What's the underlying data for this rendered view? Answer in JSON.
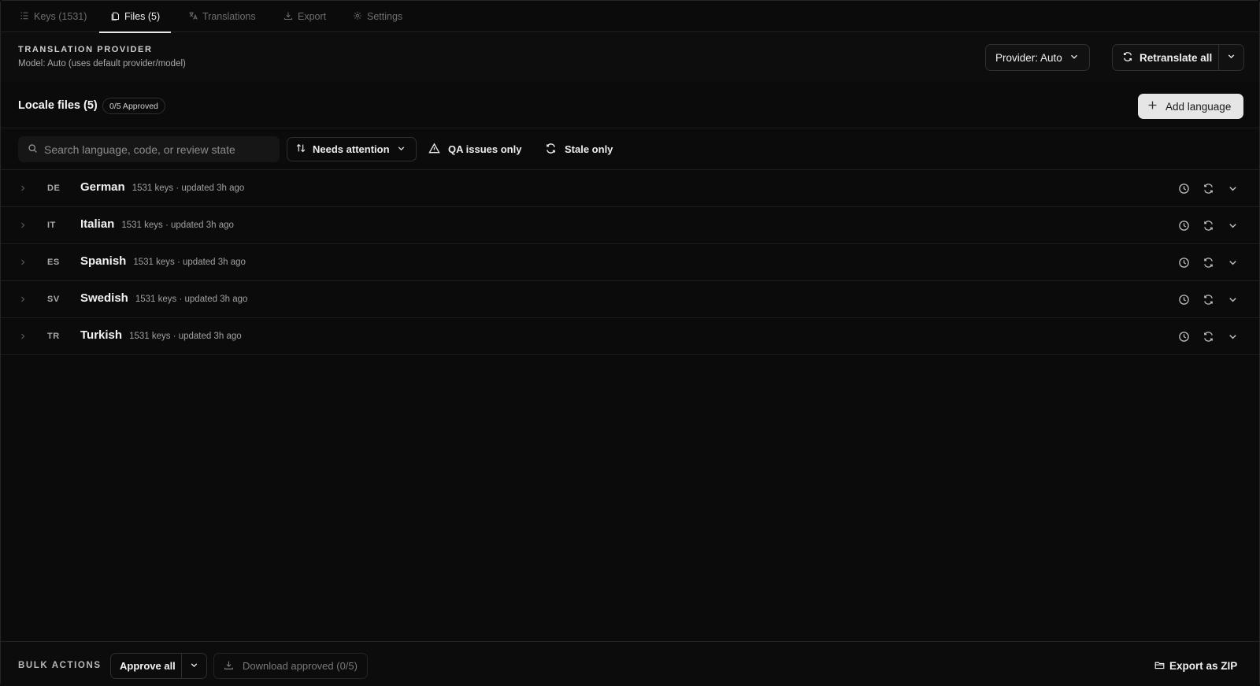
{
  "tabs": [
    {
      "label": "Keys (1531)",
      "icon": "list-icon",
      "active": false
    },
    {
      "label": "Files (5)",
      "icon": "files-icon",
      "active": true
    },
    {
      "label": "Translations",
      "icon": "translate-icon",
      "active": false
    },
    {
      "label": "Export",
      "icon": "download-icon",
      "active": false
    },
    {
      "label": "Settings",
      "icon": "gear-icon",
      "active": false
    }
  ],
  "provider": {
    "section_title": "TRANSLATION PROVIDER",
    "model_text": "Model: Auto (uses default provider/model)",
    "provider_button": "Provider: Auto",
    "retranslate_button": "Retranslate all"
  },
  "locale_header": {
    "title": "Locale files (5)",
    "approved_badge": "0/5 Approved",
    "add_button": "Add language"
  },
  "filters": {
    "search_placeholder": "Search language, code, or review state",
    "sort_label": "Needs attention",
    "qa_toggle": "QA issues only",
    "stale_toggle": "Stale only"
  },
  "locales": [
    {
      "code": "DE",
      "name": "German",
      "meta": "1531 keys · updated 3h ago"
    },
    {
      "code": "IT",
      "name": "Italian",
      "meta": "1531 keys · updated 3h ago"
    },
    {
      "code": "ES",
      "name": "Spanish",
      "meta": "1531 keys · updated 3h ago"
    },
    {
      "code": "SV",
      "name": "Swedish",
      "meta": "1531 keys · updated 3h ago"
    },
    {
      "code": "TR",
      "name": "Turkish",
      "meta": "1531 keys · updated 3h ago"
    }
  ],
  "bulk": {
    "label": "BULK ACTIONS",
    "approve_button": "Approve all",
    "download_button": "Download approved (0/5)",
    "export_button": "Export as ZIP"
  },
  "colors": {
    "background": "#0b0b0b",
    "text": "#f2f2f2",
    "muted": "#a0a0a0",
    "border": "#2e2e2e",
    "primary_button_bg": "#e6e6e6"
  }
}
